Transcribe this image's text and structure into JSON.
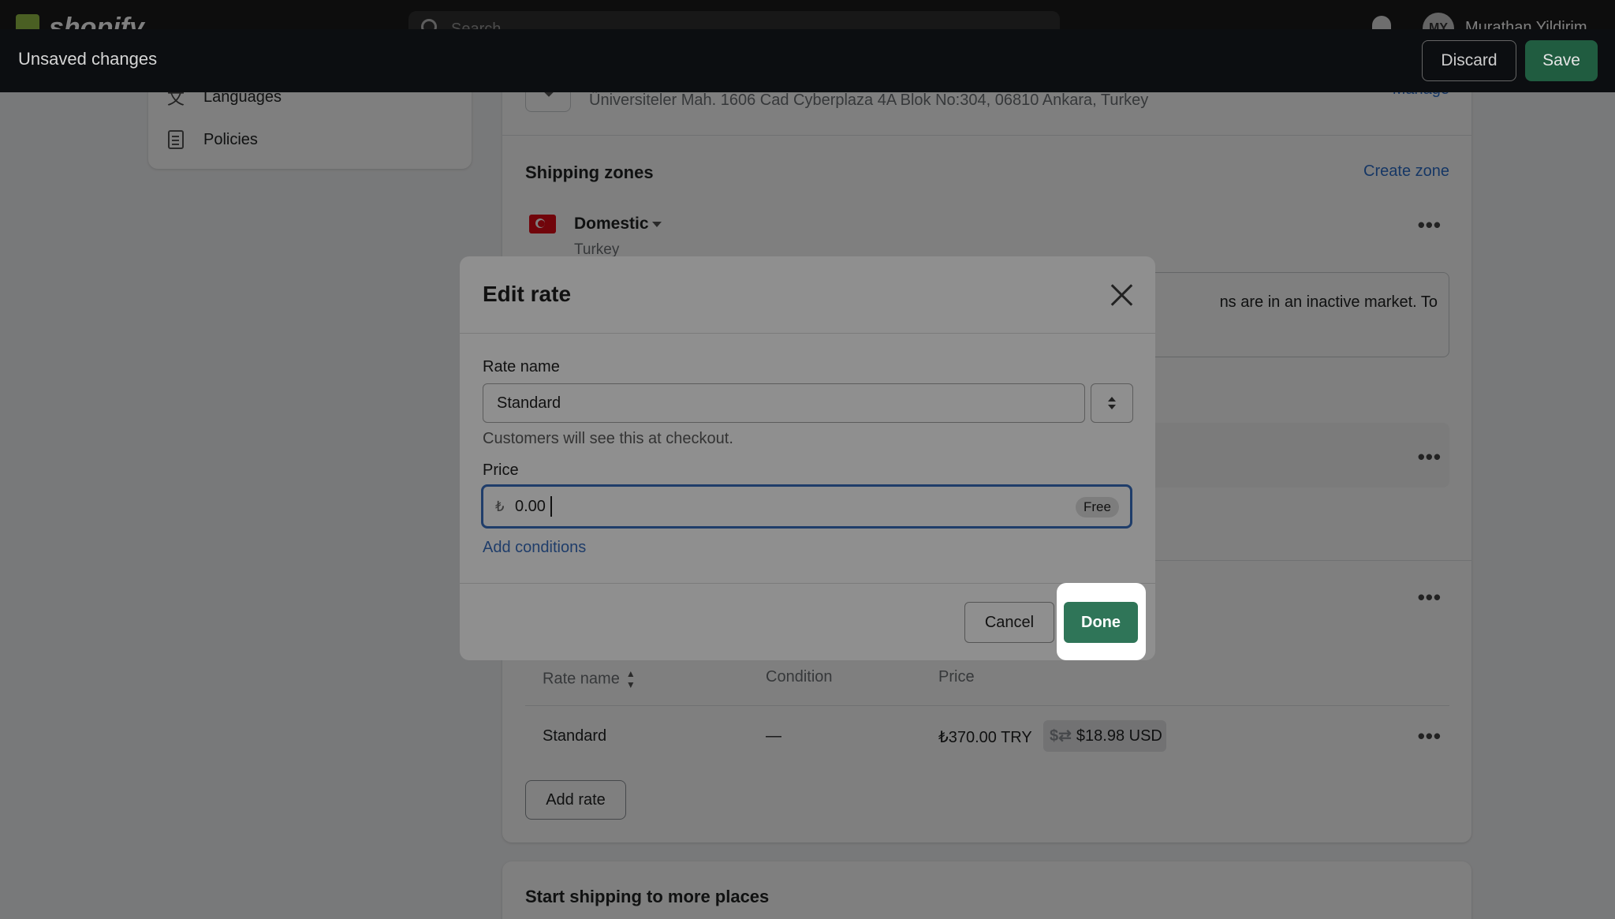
{
  "topbar": {
    "logo": "shopify",
    "search_placeholder": "Search",
    "avatar_initials": "MY",
    "user_name": "Murathan Yildirim"
  },
  "unsaved_bar": {
    "title": "Unsaved changes",
    "discard_label": "Discard",
    "save_label": "Save"
  },
  "sidebar": {
    "items": [
      {
        "label": "Languages",
        "icon": "translate-icon"
      },
      {
        "label": "Policies",
        "icon": "policy-icon"
      }
    ]
  },
  "main": {
    "location_address": "Üniversiteler Mah. 1606 Cad Cyberplaza 4A Blok No:304, 06810 Ankara, Turkey",
    "manage_label": "Manage",
    "shipping_zones_title": "Shipping zones",
    "create_zone_label": "Create zone",
    "zone": {
      "name": "Domestic",
      "country": "Turkey"
    },
    "banner_text": "ns are in an inactive market. To",
    "table": {
      "headers": [
        "Rate name",
        "Condition",
        "Price"
      ],
      "rows": [
        {
          "rate_name": "Standard",
          "condition": "—",
          "price": "₺370.00 TRY",
          "converted": "$18.98 USD"
        }
      ]
    },
    "add_rate_label": "Add rate",
    "more_places_title": "Start shipping to more places"
  },
  "modal": {
    "title": "Edit rate",
    "rate_name_label": "Rate name",
    "rate_name_value": "Standard",
    "rate_name_help": "Customers will see this at checkout.",
    "price_label": "Price",
    "currency_symbol": "₺",
    "price_value": "0.00",
    "free_badge": "Free",
    "add_conditions_label": "Add conditions",
    "cancel_label": "Cancel",
    "done_label": "Done"
  },
  "colors": {
    "primary_button": "#2f7558",
    "link": "#2c6ecb",
    "focus_ring": "#1f3d6a"
  }
}
